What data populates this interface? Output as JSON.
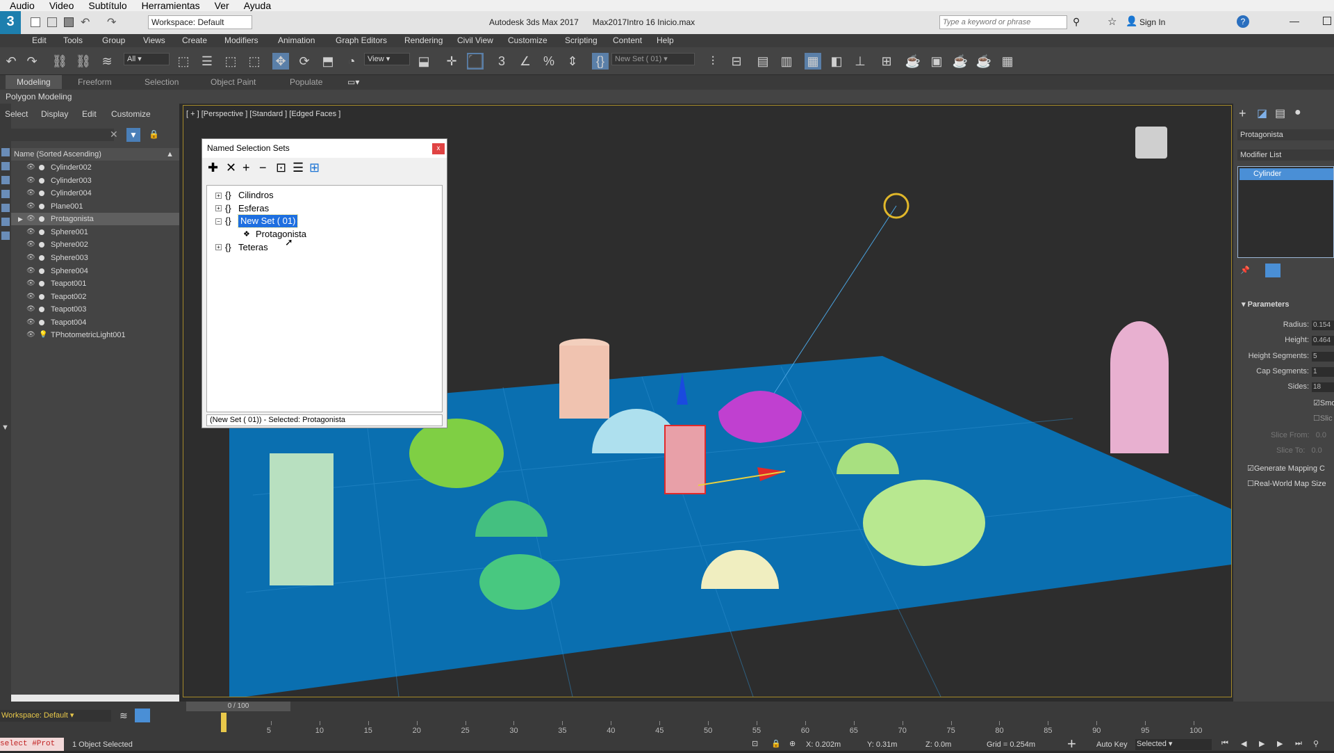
{
  "player_menu": [
    "Audio",
    "Video",
    "Subtítulo",
    "Herramientas",
    "Ver",
    "Ayuda"
  ],
  "titlebar": {
    "workspace": "Workspace: Default",
    "app_title": "Autodesk 3ds Max 2017",
    "file": "Max2017Intro 16 Inicio.max",
    "search_placeholder": "Type a keyword or phrase",
    "sign_in": "Sign In"
  },
  "menubar": [
    "Edit",
    "Tools",
    "Group",
    "Views",
    "Create",
    "Modifiers",
    "Animation",
    "Graph Editors",
    "Rendering",
    "Civil View",
    "Customize",
    "Scripting",
    "Content",
    "Help"
  ],
  "toolbar": {
    "filter": "All",
    "view": "View",
    "selset": "New Set ( 01)"
  },
  "ribbon": {
    "tabs": [
      "Modeling",
      "Freeform",
      "Selection",
      "Object Paint",
      "Populate"
    ],
    "sub": "Polygon Modeling"
  },
  "explorer": {
    "tabs": [
      "Select",
      "Display",
      "Edit",
      "Customize"
    ],
    "header": "Name (Sorted Ascending)",
    "items": [
      "Cylinder002",
      "Cylinder003",
      "Cylinder004",
      "Plane001",
      "Protagonista",
      "Sphere001",
      "Sphere002",
      "Sphere003",
      "Sphere004",
      "Teapot001",
      "Teapot002",
      "Teapot003",
      "Teapot004",
      "TPhotometricLight001"
    ],
    "selected": "Protagonista"
  },
  "viewport": {
    "label": "[ + ] [Perspective ] [Standard ] [Edged Faces ]"
  },
  "nss": {
    "title": "Named Selection Sets",
    "items": [
      "Cilindros",
      "Esferas",
      "New Set ( 01)",
      "Protagonista",
      "Teteras"
    ],
    "status": "(New Set ( 01)) - Selected: Protagonista",
    "close": "x"
  },
  "cmd": {
    "object": "Protagonista",
    "modlist": "Modifier List",
    "stack": "Cylinder",
    "rollout": "Parameters",
    "params": [
      {
        "label": "Radius:",
        "value": "0.154"
      },
      {
        "label": "Height:",
        "value": "0.464"
      },
      {
        "label": "Height Segments:",
        "value": "5"
      },
      {
        "label": "Cap Segments:",
        "value": "1"
      },
      {
        "label": "Sides:",
        "value": "18"
      }
    ],
    "smooth": "Smo",
    "slice": "Slic",
    "slice_from": "Slice From:",
    "slice_from_val": "0.0",
    "slice_to": "Slice To:",
    "slice_to_val": "0.0",
    "gen_map": "Generate Mapping C",
    "real_world": "Real-World Map Size"
  },
  "bottom": {
    "workspace": "Workspace: Default",
    "frame": "0 / 100",
    "script": "select #Prot",
    "status": "1 Object Selected",
    "x": "X: 0.202m",
    "y": "Y: 0.31m",
    "z": "Z: 0.0m",
    "grid": "Grid = 0.254m",
    "autokey": "Auto Key",
    "selected": "Selected",
    "ticks": [
      "5",
      "10",
      "15",
      "20",
      "25",
      "30",
      "35",
      "40",
      "45",
      "50",
      "55",
      "60",
      "65",
      "70",
      "75",
      "80",
      "85",
      "90",
      "95",
      "100"
    ]
  },
  "colors": {
    "accent": "#1c74d4",
    "selection": "#1e6fe0",
    "viewport_border": "#a58a2a",
    "plane": "#0a6fb0"
  }
}
